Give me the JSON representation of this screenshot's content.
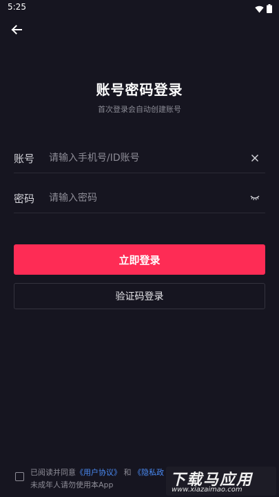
{
  "status_bar": {
    "time": "5:25",
    "icons": [
      "wifi-icon",
      "battery-icon"
    ]
  },
  "header": {
    "back_icon": "arrow-left-icon",
    "title": "账号密码登录",
    "subtitle": "首次登录会自动创建账号"
  },
  "form": {
    "account": {
      "label": "账号",
      "placeholder": "请输入手机号/ID账号",
      "value": "",
      "icon": "clear-icon"
    },
    "password": {
      "label": "密码",
      "placeholder": "请输入密码",
      "value": "",
      "icon": "eye-hidden-icon"
    }
  },
  "actions": {
    "login_label": "立即登录",
    "code_login_label": "验证码登录"
  },
  "agreement": {
    "checked": false,
    "prefix": "已阅读并同意",
    "user_agreement": "《用户协议》",
    "and": "和",
    "privacy_policy": "《隐私政",
    "line2": "未成年人请勿使用本App"
  },
  "watermark": {
    "main": "下载马应用",
    "sub": "www.xiazaimao.com"
  },
  "colors": {
    "background": "#161520",
    "accent": "#fe2c55",
    "link": "#4a8bf5",
    "muted_text": "#8e8d97"
  }
}
